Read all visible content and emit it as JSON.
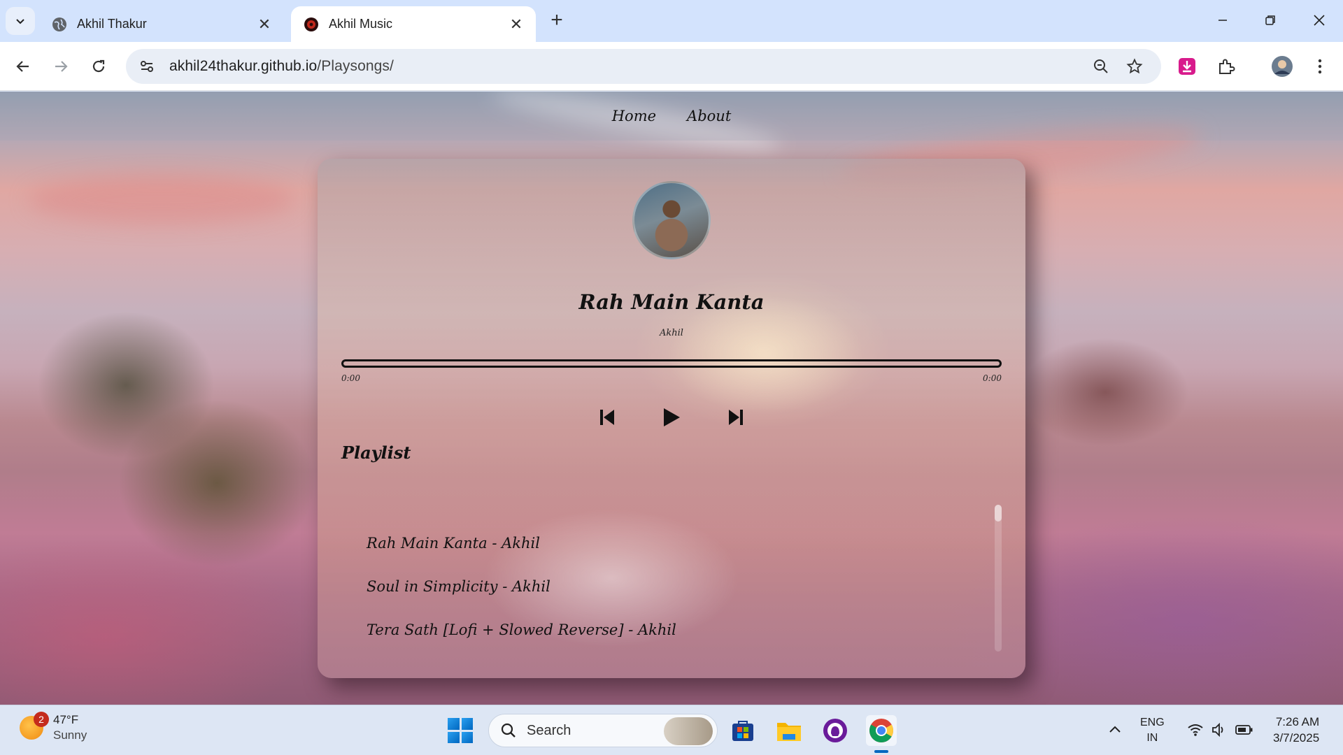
{
  "browser": {
    "tabs": [
      {
        "title": "Akhil Thakur",
        "active": false
      },
      {
        "title": "Akhil Music",
        "active": true
      }
    ],
    "url_host": "akhil24thakur.github.io",
    "url_path": "/Playsongs/"
  },
  "site_nav": {
    "links": [
      "Home",
      "About"
    ]
  },
  "player": {
    "song_title": "Rah Main Kanta",
    "artist": "Akhil",
    "progress": 0,
    "time_current": "0:00",
    "time_total": "0:00",
    "playlist_heading": "Playlist",
    "playlist": [
      "Rah Main Kanta - Akhil",
      "Soul in Simplicity - Akhil",
      "Tera Sath [Lofi + Slowed Reverse] - Akhil"
    ]
  },
  "taskbar": {
    "weather_temp": "47°F",
    "weather_condition": "Sunny",
    "weather_badge": "2",
    "search_label": "Search",
    "lang_line1": "ENG",
    "lang_line2": "IN",
    "time": "7:26 AM",
    "date": "3/7/2025"
  },
  "colors": {
    "tabbar": "#d3e3fd",
    "omnibox": "#e9eef6",
    "taskbar": "#dde6f4",
    "accent": "#0067c0"
  }
}
